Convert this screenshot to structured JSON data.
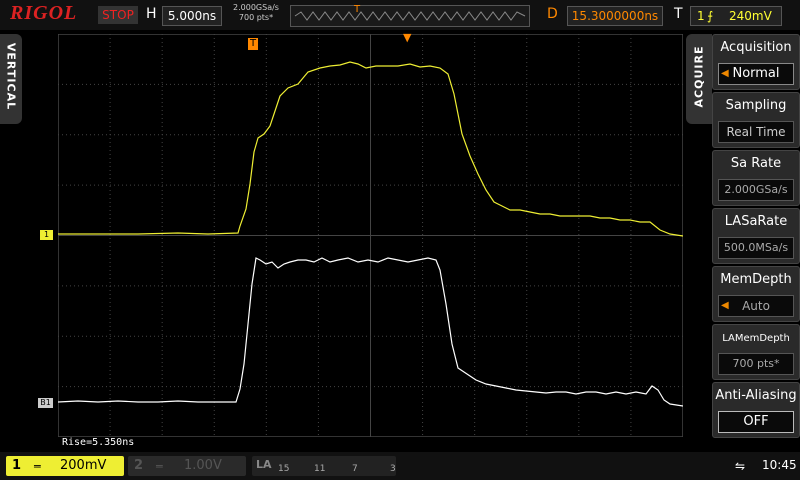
{
  "top": {
    "brand": "RIGOL",
    "status": "STOP",
    "h_label": "H",
    "h_value": "5.000ns",
    "sample_rate": "2.000GSa/s",
    "points": "700 pts*",
    "d_label": "D",
    "d_value": "15.3000000ns",
    "t_label": "T",
    "trigger_source": "1",
    "trigger_level": "240mV"
  },
  "tabs": {
    "vertical": "VERTICAL",
    "acquire": "ACQUIRE"
  },
  "menu": {
    "items": [
      {
        "title": "Acquisition",
        "value": "Normal"
      },
      {
        "title": "Sampling",
        "value": "Real Time"
      },
      {
        "title": "Sa Rate",
        "value": "2.000GSa/s"
      },
      {
        "title": "LASaRate",
        "value": "500.0MSa/s"
      },
      {
        "title": "MemDepth",
        "value": "Auto"
      },
      {
        "title": "LAMemDepth",
        "value": "700  pts*"
      },
      {
        "title": "Anti-Aliasing",
        "value": "OFF"
      }
    ]
  },
  "markers": {
    "ch1": "1",
    "b1": "B1",
    "trig": "T"
  },
  "measurement": "Rise=5.350ns",
  "bottom": {
    "ch1_num": "1",
    "ch1_scale": "200mV",
    "ch2_num": "2",
    "ch2_scale": "1.00V",
    "la_label": "LA",
    "la_bits": [
      "15",
      "11",
      "7",
      "3"
    ],
    "time": "10:45"
  },
  "colors": {
    "ch1": "#eeee33",
    "digital": "#ffffff",
    "accent": "#ff8800",
    "stop": "#ee2222",
    "grid": "#555555"
  }
}
